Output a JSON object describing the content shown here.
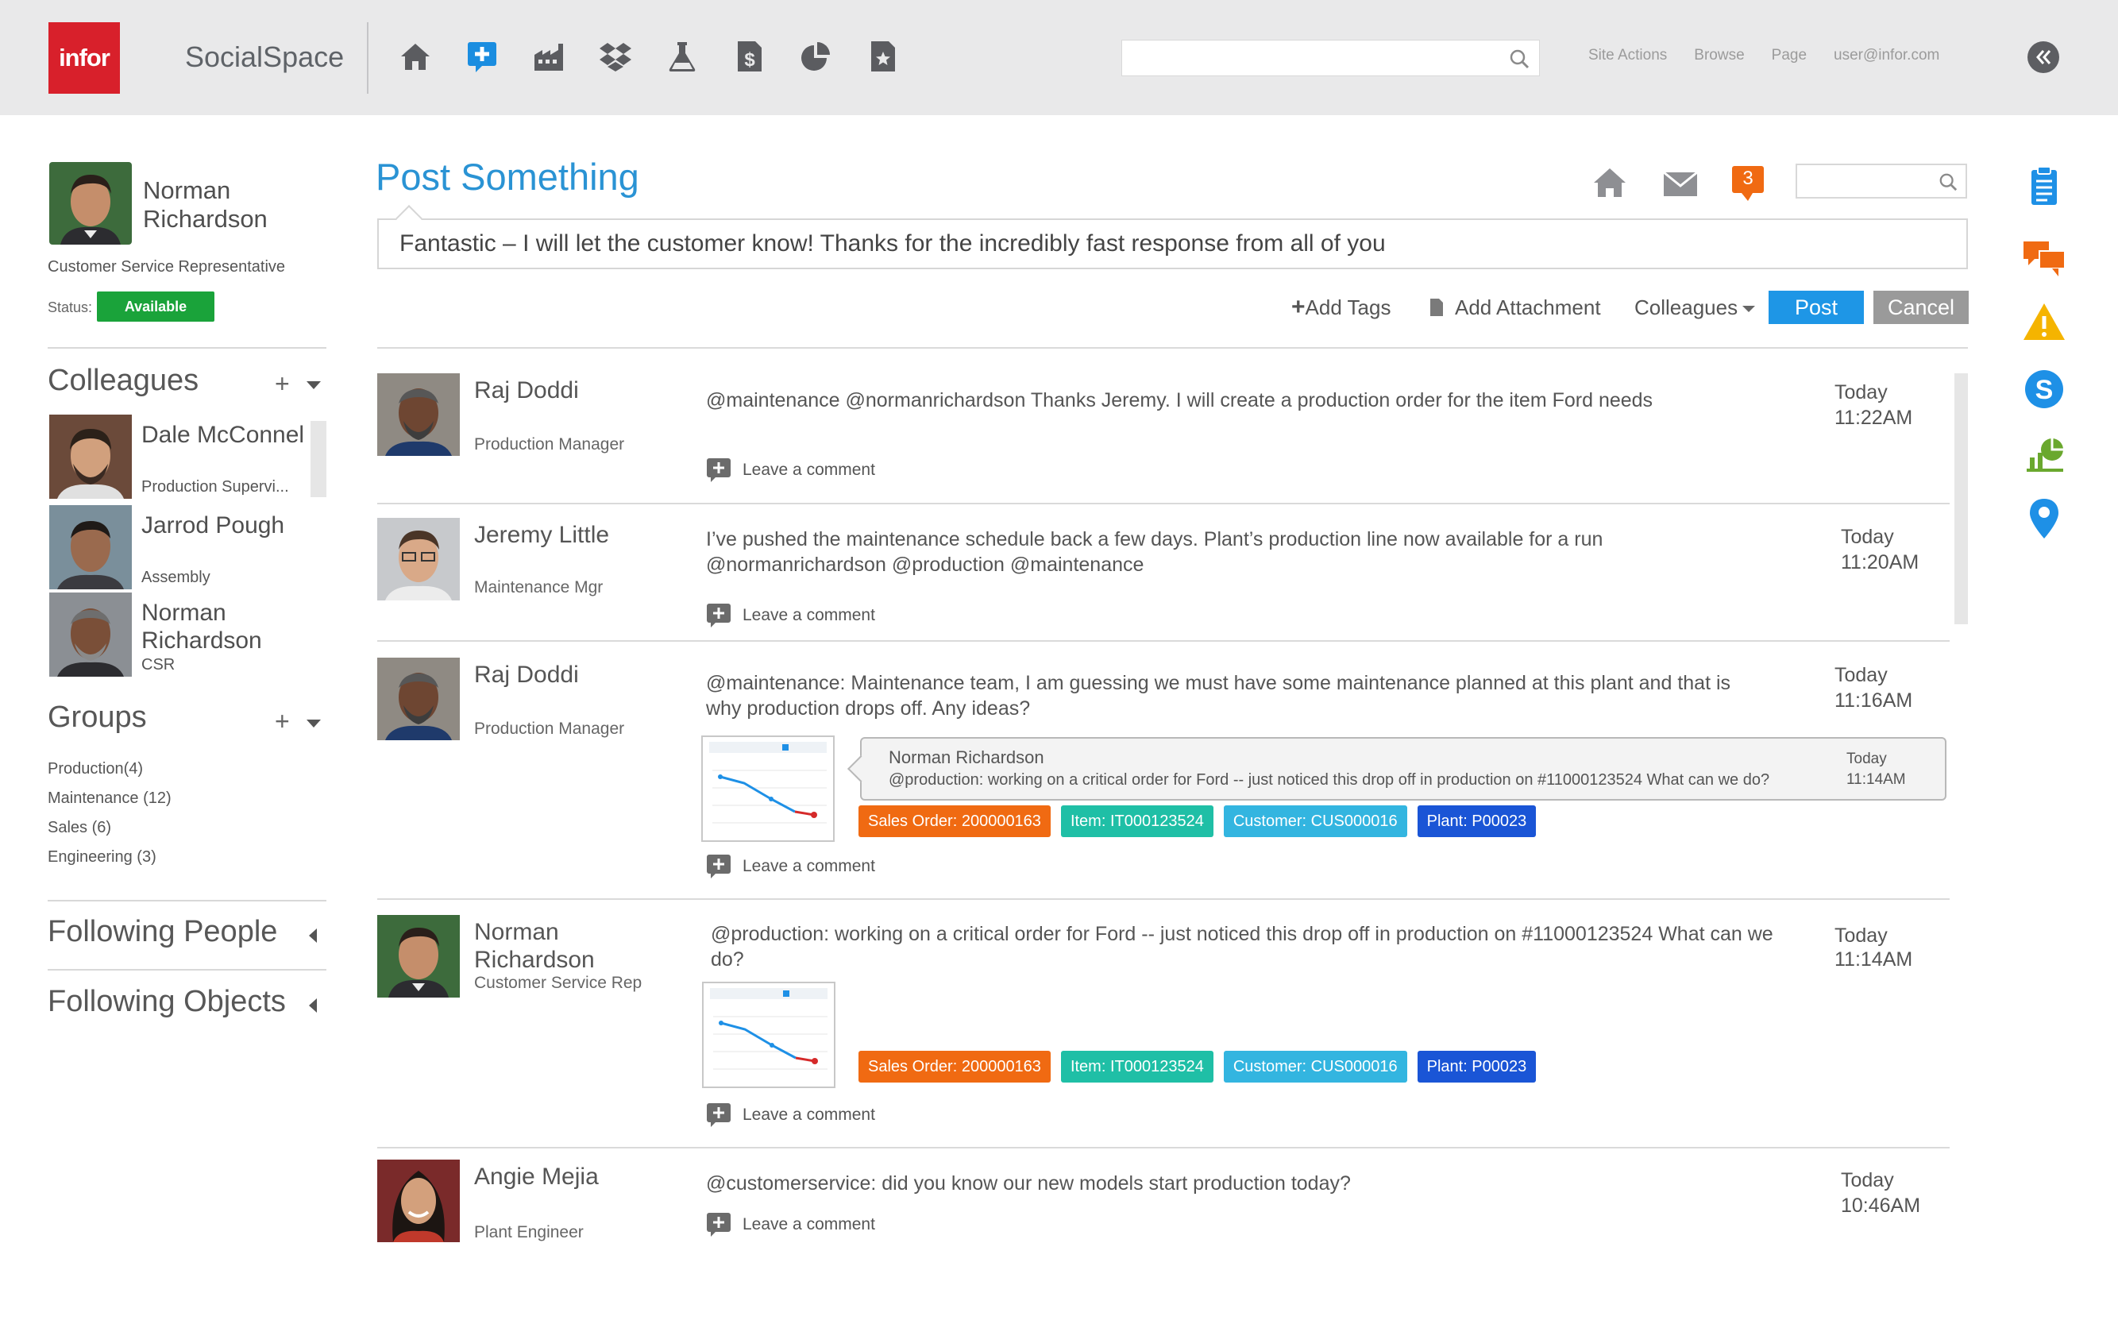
{
  "app": {
    "logo_text": "infor",
    "name": "SocialSpace",
    "top_icons": [
      "home-icon",
      "add-post-icon",
      "factory-icon",
      "dropbox-icon",
      "flask-icon",
      "dollar-doc-icon",
      "pie-chart-icon",
      "star-doc-icon"
    ],
    "links": [
      "Site Actions",
      "Browse",
      "Page",
      "user@infor.com"
    ],
    "colors": {
      "brand_red": "#d8202b",
      "accent_blue": "#2a93d4",
      "available_green": "#1aa33a"
    }
  },
  "profile": {
    "name": "Norman Richardson",
    "role": "Customer Service Representative",
    "status_label": "Status:",
    "status_value": "Available"
  },
  "colleagues": {
    "heading": "Colleagues",
    "items": [
      {
        "name": "Dale McConnel",
        "role": "Production Supervi..."
      },
      {
        "name": "Jarrod Pough",
        "role": "Assembly"
      },
      {
        "name": "Norman Richardson",
        "role": "CSR"
      }
    ]
  },
  "groups": {
    "heading": "Groups",
    "items": [
      "Production(4)",
      "Maintenance (12)",
      "Sales (6)",
      "Engineering (3)"
    ]
  },
  "following_people": "Following People",
  "following_objects": "Following Objects",
  "composer": {
    "title": "Post Something",
    "notification_count": "3",
    "input_value": "Fantastic – I will let the customer know! Thanks for the incredibly fast response from all of you",
    "add_tags": "Add Tags",
    "add_attachment": "Add Attachment",
    "colleagues_dropdown": "Colleagues",
    "post": "Post",
    "cancel": "Cancel"
  },
  "feed": {
    "comment_label": "Leave a comment",
    "items": [
      {
        "name": "Raj Doddi",
        "role": "Production Manager",
        "message": "@maintenance @normanrichardson Thanks Jeremy. I will create a production order for the item Ford needs",
        "day": "Today",
        "time": "11:22AM"
      },
      {
        "name": "Jeremy Little",
        "role": "Maintenance Mgr",
        "message": "I’ve pushed the maintenance schedule back a few days. Plant’s production line now available for a run @normanrichardson @production @maintenance",
        "day": "Today",
        "time": "11:20AM"
      },
      {
        "name": "Raj Doddi",
        "role": "Production Manager",
        "message": "@maintenance: Maintenance team, I am guessing we must have some maintenance planned at this plant and that is why production drops off.  Any ideas?",
        "day": "Today",
        "time": "11:16AM",
        "quote": {
          "name": "Norman Richardson",
          "message": "@production: working on a critical order for Ford -- just noticed this drop off in production on #11000123524 What can we do?",
          "day": "Today",
          "time": "11:14AM"
        }
      },
      {
        "name": "Norman Richardson",
        "role": "Customer Service Rep",
        "message": "@production: working on a critical order for Ford -- just noticed this drop off in production on #11000123524 What can we do?",
        "day": "Today",
        "time": "11:14AM"
      },
      {
        "name": "Angie Mejia",
        "role": "Plant Engineer",
        "message": "@customerservice: did you know our new models start production today?",
        "day": "Today",
        "time": "10:46AM"
      }
    ],
    "tags": [
      {
        "label": "Sales Order: 200000163",
        "color": "#f06a12"
      },
      {
        "label": "Item: IT000123524",
        "color": "#1fbfa6"
      },
      {
        "label": "Customer: CUS000016",
        "color": "#33b5e0"
      },
      {
        "label": "Plant: P00023",
        "color": "#1a55d6"
      }
    ]
  },
  "right_rail": [
    "clipboard-icon",
    "chat-bubbles-icon",
    "warning-icon",
    "skype-icon",
    "chart-icon",
    "map-pin-icon"
  ]
}
